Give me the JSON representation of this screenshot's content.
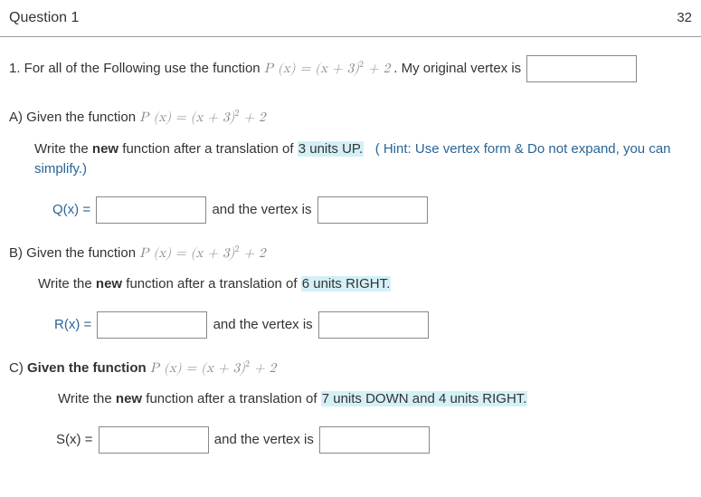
{
  "header": {
    "title": "Question 1",
    "points": "32"
  },
  "intro": {
    "prefix": "1. For all of the Following use the function ",
    "formula_html": "P (x)  =  (x + 3)<sup>2</sup> + 2",
    "suffix": " . My original vertex is "
  },
  "partA": {
    "lead": "A) Given the function ",
    "formula_html": "P (x)  =  (x + 3)<sup>2</sup> + 2",
    "write_prefix": "Write the ",
    "write_bold": "new",
    "write_suffix": " function after a translation of ",
    "translation": "3 units UP.",
    "hint": "( Hint: Use vertex form & Do not expand, you can simplify.)",
    "func_prefix": "Q(x) = ",
    "vertex_label": " and the vertex is "
  },
  "partB": {
    "lead": "B) Given the function ",
    "formula_html": "P (x)  =  (x + 3)<sup>2</sup> + 2",
    "write_prefix": "Write the ",
    "write_bold": "new",
    "write_suffix": " function after a translation of ",
    "translation": "6 units RIGHT.",
    "func_prefix": "R(x) = ",
    "vertex_label": " and the vertex is "
  },
  "partC": {
    "lead": "C) ",
    "lead_bold": "Given the function ",
    "formula_html": "P (x)  =  (x + 3)<sup>2</sup> + 2",
    "write_prefix": "Write the ",
    "write_bold": "new",
    "write_suffix": " function after a translation of ",
    "translation": "7 units DOWN and 4 units RIGHT.",
    "func_prefix": "S(x) = ",
    "vertex_label": " and the vertex is "
  }
}
